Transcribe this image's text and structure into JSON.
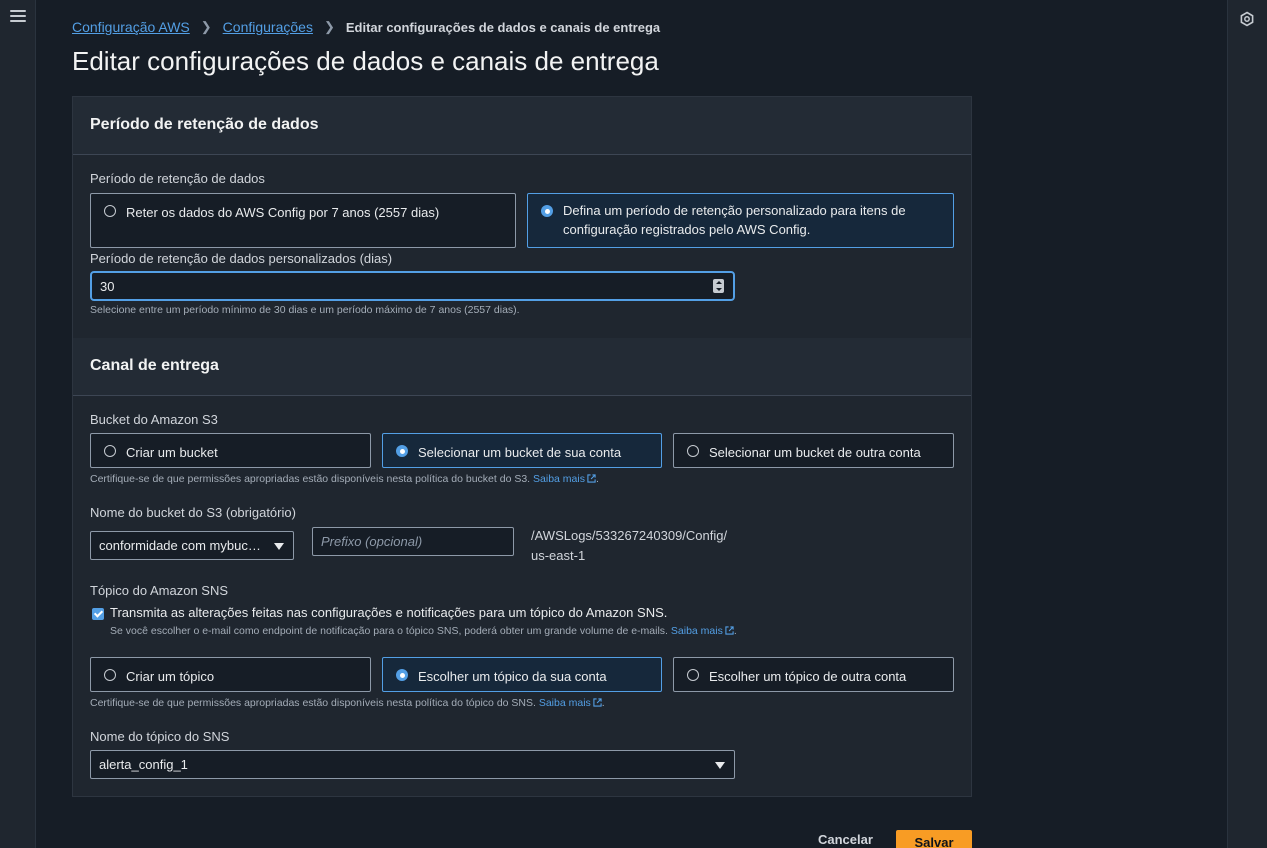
{
  "breadcrumb": {
    "item1": "Configuração AWS",
    "item2": "Configurações",
    "current": "Editar configurações de dados e canais de entrega"
  },
  "page_title": "Editar configurações de dados e canais de entrega",
  "retention": {
    "header": "Período de retenção de dados",
    "group_label": "Período de retenção de dados",
    "option_default": "Reter os dados do AWS Config por 7 anos (2557 dias)",
    "option_custom": "Defina um período de retenção personalizado para itens de configuração registrados pelo AWS Config.",
    "selected": "custom",
    "custom_label": "Período de retenção de dados personalizados (dias)",
    "custom_value": "30",
    "custom_hint": "Selecione entre um período mínimo de 30 dias e um período máximo de 7 anos (2557 dias)."
  },
  "delivery": {
    "header": "Canal de entrega",
    "s3_label": "Bucket do Amazon S3",
    "s3_options": [
      "Criar um bucket",
      "Selecionar um bucket de sua conta",
      "Selecionar um bucket de outra conta"
    ],
    "s3_selected_index": 1,
    "s3_hint": "Certifique-se de que permissões apropriadas estão disponíveis nesta política do bucket do S3.",
    "learn_more": "Saiba mais",
    "bucket_name_label": "Nome do bucket do S3 (obrigatório)",
    "bucket_name_value": "conformidade com mybuc…",
    "prefix_placeholder": "Prefixo (opcional)",
    "path_line1": "/AWSLogs/533267240309/Config/",
    "path_line2": "us-east-1",
    "sns_label": "Tópico do Amazon SNS",
    "sns_checkbox": "Transmita as alterações feitas nas configurações e notificações para um tópico do Amazon SNS.",
    "sns_checkbox_checked": true,
    "sns_checkbox_hint": "Se você escolher o e-mail como endpoint de notificação para o tópico SNS, poderá obter um grande volume de e-mails.",
    "sns_options": [
      "Criar um tópico",
      "Escolher um tópico da sua conta",
      "Escolher um tópico de outra conta"
    ],
    "sns_selected_index": 1,
    "sns_hint": "Certifique-se de que permissões apropriadas estão disponíveis nesta política do tópico do SNS.",
    "topic_name_label": "Nome do tópico do SNS",
    "topic_name_value": "alerta_config_1"
  },
  "actions": {
    "cancel": "Cancelar",
    "save": "Salvar"
  },
  "icons": {
    "menu": "hamburger-menu-icon",
    "settings": "hexagon-settings-icon",
    "external": "external-link-icon"
  },
  "colors": {
    "accent": "#539fe5",
    "primary_button": "#f89c24",
    "background": "#161d26"
  }
}
